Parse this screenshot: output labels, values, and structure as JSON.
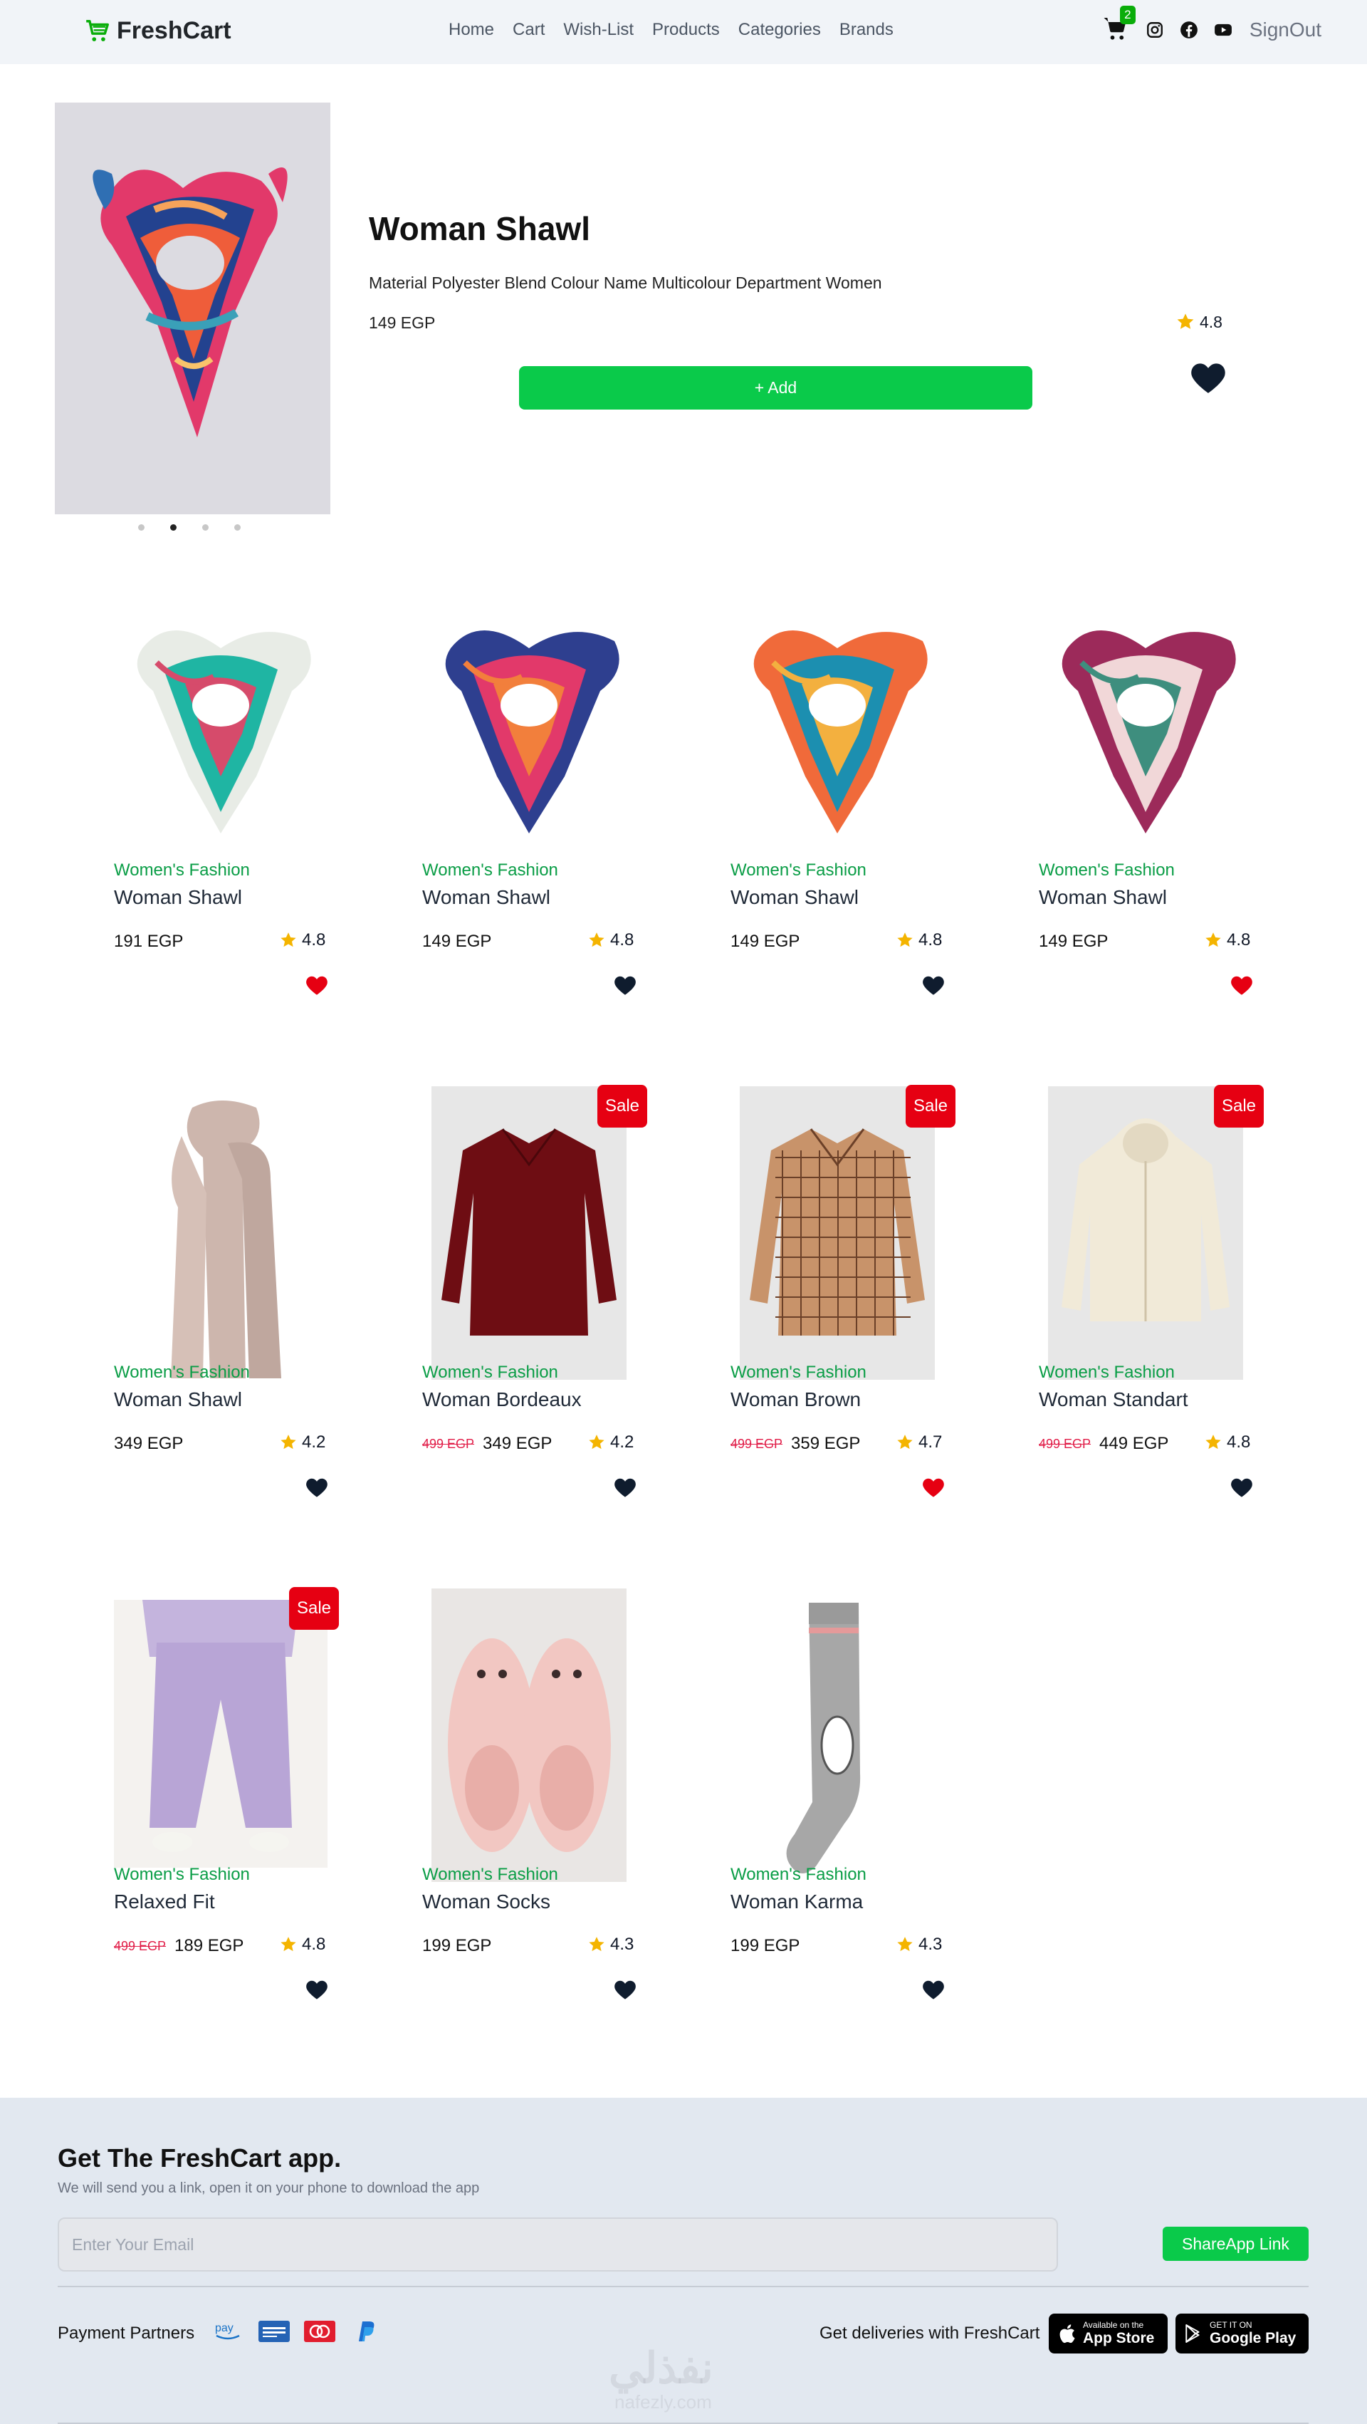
{
  "navbar": {
    "brand": "FreshCart",
    "links": [
      "Home",
      "Cart",
      "Wish-List",
      "Products",
      "Categories",
      "Brands"
    ],
    "cart_count": "2",
    "signout": "SignOut"
  },
  "hero": {
    "title": "Woman Shawl",
    "description": "Material Polyester Blend Colour Name Multicolour Department Women",
    "price": "149 EGP",
    "rating": "4.8",
    "add_label": "+ Add",
    "carousel_active": 2,
    "carousel_count": 4
  },
  "products": [
    {
      "category": "Women's Fashion",
      "name": "Woman Shawl",
      "price": "191 EGP",
      "old_price": "",
      "rating": "4.8",
      "wishlisted": true,
      "sale": false
    },
    {
      "category": "Women's Fashion",
      "name": "Woman Shawl",
      "price": "149 EGP",
      "old_price": "",
      "rating": "4.8",
      "wishlisted": false,
      "sale": false
    },
    {
      "category": "Women's Fashion",
      "name": "Woman Shawl",
      "price": "149 EGP",
      "old_price": "",
      "rating": "4.8",
      "wishlisted": false,
      "sale": false
    },
    {
      "category": "Women's Fashion",
      "name": "Woman Shawl",
      "price": "149 EGP",
      "old_price": "",
      "rating": "4.8",
      "wishlisted": true,
      "sale": false
    },
    {
      "category": "Women's Fashion",
      "name": "Woman Shawl",
      "price": "349 EGP",
      "old_price": "",
      "rating": "4.2",
      "wishlisted": false,
      "sale": false
    },
    {
      "category": "Women's Fashion",
      "name": "Woman Bordeaux",
      "price": "349 EGP",
      "old_price": "499 EGP",
      "rating": "4.2",
      "wishlisted": false,
      "sale": true
    },
    {
      "category": "Women's Fashion",
      "name": "Woman Brown",
      "price": "359 EGP",
      "old_price": "499 EGP",
      "rating": "4.7",
      "wishlisted": true,
      "sale": true
    },
    {
      "category": "Women's Fashion",
      "name": "Woman Standart",
      "price": "449 EGP",
      "old_price": "499 EGP",
      "rating": "4.8",
      "wishlisted": false,
      "sale": true
    },
    {
      "category": "Women's Fashion",
      "name": "Relaxed Fit",
      "price": "189 EGP",
      "old_price": "499 EGP",
      "rating": "4.8",
      "wishlisted": false,
      "sale": true
    },
    {
      "category": "Women's Fashion",
      "name": "Woman Socks",
      "price": "199 EGP",
      "old_price": "",
      "rating": "4.3",
      "wishlisted": false,
      "sale": false
    },
    {
      "category": "Women's Fashion",
      "name": "Woman Karma",
      "price": "199 EGP",
      "old_price": "",
      "rating": "4.3",
      "wishlisted": false,
      "sale": false
    }
  ],
  "sale_label": "Sale",
  "footer": {
    "title": "Get The FreshCart app.",
    "subtitle": "We will send you a link, open it on your phone to download the app",
    "email_placeholder": "Enter Your Email",
    "share_label": "ShareApp Link",
    "payment_label": "Payment Partners",
    "payment_icons": [
      "amazon-pay-icon",
      "american-express-icon",
      "mastercard-icon",
      "paypal-icon"
    ],
    "deliveries_label": "Get deliveries with FreshCart",
    "app_store_small": "Available on the",
    "app_store_big": "App Store",
    "google_play_small": "GET IT ON",
    "google_play_big": "Google Play",
    "watermark": "نفذلي",
    "watermark_sub": "nafezly.com"
  },
  "colors": {
    "brand_green": "#0aad0a",
    "category_green": "#0a9d46",
    "button_green": "#0aca4a",
    "heart_red": "#e60012",
    "heart_navy": "#0f1c2e",
    "star": "#f4b400"
  }
}
